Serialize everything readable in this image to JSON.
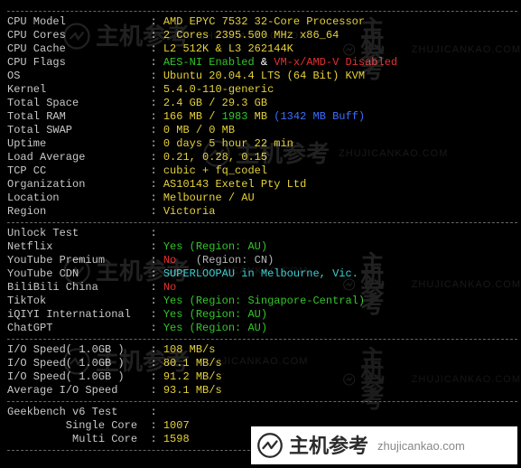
{
  "watermark_cn": "主机参考",
  "watermark_en": "ZHUJICANKAO.COM",
  "footer_cn": "主机参考",
  "footer_en": "zhujicankao.com",
  "sys": [
    {
      "label": "CPU Model",
      "parts": [
        {
          "cls": "yellow",
          "txt": "AMD EPYC 7532 32-Core Processor"
        }
      ]
    },
    {
      "label": "CPU Cores",
      "parts": [
        {
          "cls": "yellow",
          "txt": "2 Cores 2395.500 MHz x86_64"
        }
      ]
    },
    {
      "label": "CPU Cache",
      "parts": [
        {
          "cls": "yellow",
          "txt": "L2 512K & L3 262144K"
        }
      ]
    },
    {
      "label": "CPU Flags",
      "parts": [
        {
          "cls": "green",
          "txt": "AES-NI Enabled"
        },
        {
          "cls": "white",
          "txt": " & "
        },
        {
          "cls": "red",
          "txt": "VM-x/AMD-V Disabled"
        }
      ]
    },
    {
      "label": "OS",
      "parts": [
        {
          "cls": "yellow",
          "txt": "Ubuntu 20.04.4 LTS (64 Bit) KVM"
        }
      ]
    },
    {
      "label": "Kernel",
      "parts": [
        {
          "cls": "yellow",
          "txt": "5.4.0-110-generic"
        }
      ]
    },
    {
      "label": "Total Space",
      "parts": [
        {
          "cls": "yellow",
          "txt": "2.4 GB / 29.3 GB"
        }
      ]
    },
    {
      "label": "Total RAM",
      "parts": [
        {
          "cls": "yellow",
          "txt": "166 MB / "
        },
        {
          "cls": "green",
          "txt": "1983"
        },
        {
          "cls": "yellow",
          "txt": " MB "
        },
        {
          "cls": "blue",
          "txt": "(1342 MB Buff)"
        }
      ]
    },
    {
      "label": "Total SWAP",
      "parts": [
        {
          "cls": "yellow",
          "txt": "0 MB / 0 MB"
        }
      ]
    },
    {
      "label": "Uptime",
      "parts": [
        {
          "cls": "yellow",
          "txt": "0 days 5 hour 22 min"
        }
      ]
    },
    {
      "label": "Load Average",
      "parts": [
        {
          "cls": "yellow",
          "txt": "0.21, 0.28, 0.15"
        }
      ]
    },
    {
      "label": "TCP CC",
      "parts": [
        {
          "cls": "yellow",
          "txt": "cubic + fq_codel"
        }
      ]
    },
    {
      "label": "Organization",
      "parts": [
        {
          "cls": "yellow",
          "txt": "AS10143 Exetel Pty Ltd"
        }
      ]
    },
    {
      "label": "Location",
      "parts": [
        {
          "cls": "yellow",
          "txt": "Melbourne / AU"
        }
      ]
    },
    {
      "label": "Region",
      "parts": [
        {
          "cls": "yellow",
          "txt": "Victoria"
        }
      ]
    }
  ],
  "unlock_header": "Unlock Test",
  "unlock": [
    {
      "label": "Netflix",
      "parts": [
        {
          "cls": "green",
          "txt": "Yes (Region: AU)"
        }
      ]
    },
    {
      "label": "YouTube Premium",
      "parts": [
        {
          "cls": "red",
          "txt": "No"
        },
        {
          "cls": "lightgray",
          "txt": "   (Region: CN)"
        }
      ]
    },
    {
      "label": "YouTube CDN",
      "parts": [
        {
          "cls": "cyan",
          "txt": "SUPERLOOPAU in Melbourne, Vic."
        }
      ]
    },
    {
      "label": "BiliBili China",
      "parts": [
        {
          "cls": "red",
          "txt": "No"
        }
      ]
    },
    {
      "label": "TikTok",
      "parts": [
        {
          "cls": "green",
          "txt": "Yes (Region: Singapore-Central)"
        }
      ]
    },
    {
      "label": "iQIYI International",
      "parts": [
        {
          "cls": "green",
          "txt": "Yes (Region: AU)"
        }
      ]
    },
    {
      "label": "ChatGPT",
      "parts": [
        {
          "cls": "green",
          "txt": "Yes (Region: AU)"
        }
      ]
    }
  ],
  "io": [
    {
      "label": "I/O Speed( 1.0GB )",
      "parts": [
        {
          "cls": "yellow",
          "txt": "108 MB/s"
        }
      ]
    },
    {
      "label": "I/O Speed( 1.0GB )",
      "parts": [
        {
          "cls": "yellow",
          "txt": "80.1 MB/s"
        }
      ]
    },
    {
      "label": "I/O Speed( 1.0GB )",
      "parts": [
        {
          "cls": "yellow",
          "txt": "91.2 MB/s"
        }
      ]
    },
    {
      "label": "Average I/O Speed",
      "parts": [
        {
          "cls": "yellow",
          "txt": "93.1 MB/s"
        }
      ]
    }
  ],
  "geekbench_header": "Geekbench v6 Test",
  "geekbench": [
    {
      "label": "         Single Core",
      "parts": [
        {
          "cls": "yellow",
          "txt": "1007"
        }
      ]
    },
    {
      "label": "          Multi Core",
      "parts": [
        {
          "cls": "yellow",
          "txt": "1598"
        }
      ]
    }
  ]
}
